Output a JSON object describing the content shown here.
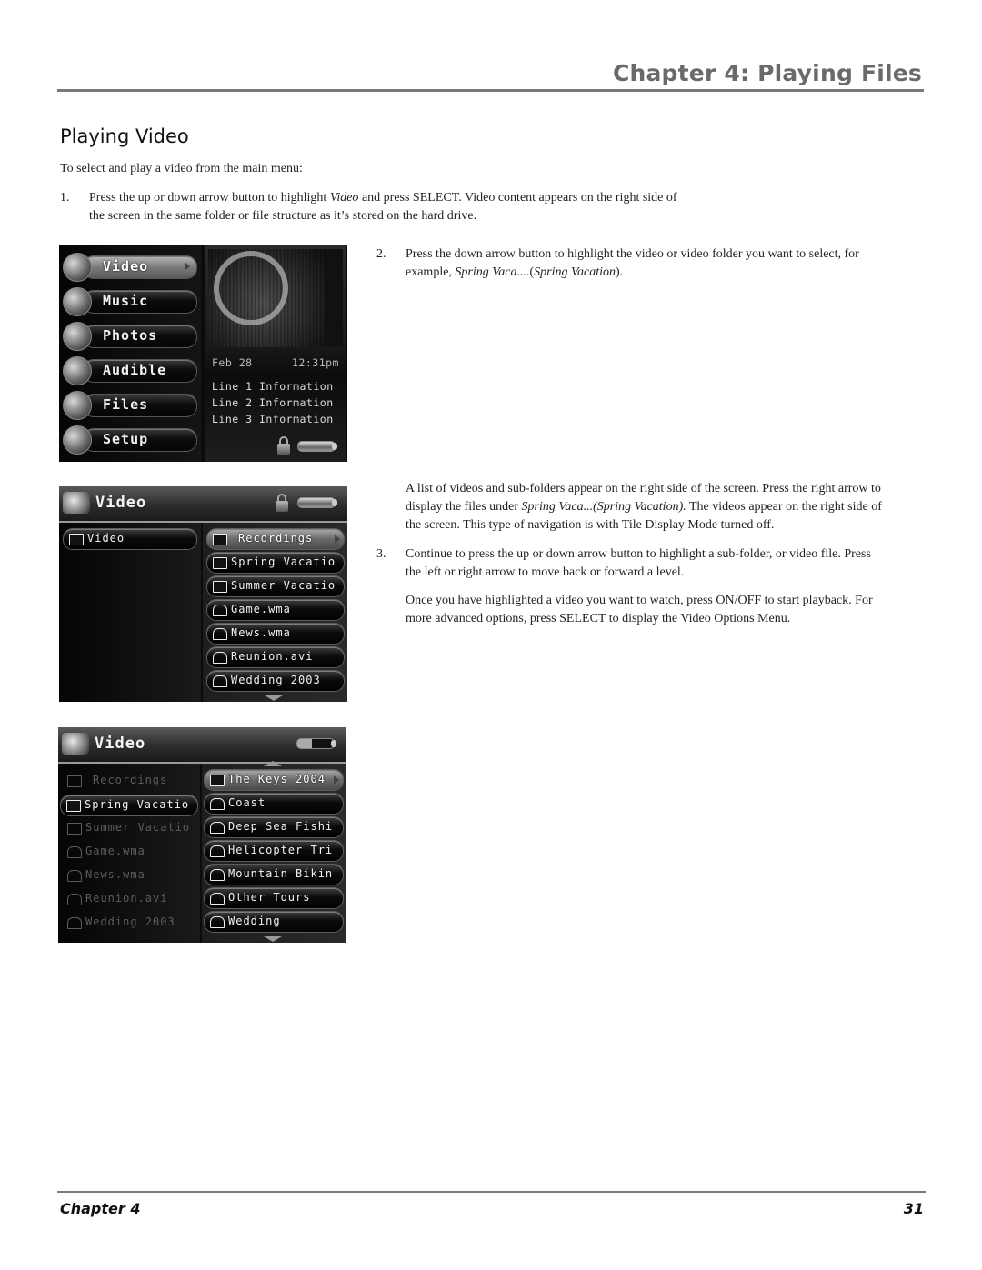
{
  "header": {
    "chapter_title": "Chapter 4: Playing Files"
  },
  "section": {
    "title": "Playing Video",
    "intro": "To select and play a video from the main menu:"
  },
  "steps": [
    {
      "num": "1.",
      "line1_a": "Press the up or down arrow button to highlight ",
      "line1_em": "Video",
      "line1_b": " and press SELECT. Video content appears on the right side of",
      "line2": "the screen in the same folder or file structure as it’s stored on the hard drive."
    },
    {
      "num": "2.",
      "line1": "Press the down arrow button to highlight the video or video folder you want to select, for",
      "line2_a": "example, ",
      "line2_em1": "Spring Vaca...",
      "line2_b": ".(",
      "line2_em2": "Spring Vacation",
      "line2_c": ")."
    },
    {
      "num": "3.",
      "line1": "Continue to press the up or down arrow button to highlight a sub-folder, or video file. Press",
      "line2": "the left or right arrow to move back or forward a level."
    }
  ],
  "paragraphs": {
    "list_desc_l1": "A list of videos and sub-folders appear on the right side of the screen. Press the right arrow to",
    "list_desc_l2_a": "display the files under ",
    "list_desc_l2_em": "Spring Vaca...(Spring Vacation).",
    "list_desc_l2_b": " The videos appear on the right side of",
    "list_desc_l3": "the screen. This type of navigation is with Tile Display Mode turned off.",
    "playback_l1": "Once you have highlighted a video you want to watch, press ON/OFF to start playback. For",
    "playback_l2": "more advanced options, press SELECT to display the Video Options Menu."
  },
  "screen1": {
    "menu": [
      {
        "label": "Video",
        "icon": "camcorder-icon",
        "active": true
      },
      {
        "label": "Music",
        "icon": "headphones-icon"
      },
      {
        "label": "Photos",
        "icon": "camera-icon"
      },
      {
        "label": "Audible",
        "icon": "speaker-book-icon"
      },
      {
        "label": "Files",
        "icon": "files-icon"
      },
      {
        "label": "Setup",
        "icon": "gear-icon"
      }
    ],
    "date": "Feb 28",
    "time": "12:31pm",
    "info_lines": [
      "Line 1 Information",
      "Line 2 Information",
      "Line 3 Information"
    ]
  },
  "screen2": {
    "title": "Video",
    "left": [
      {
        "label": "Video",
        "icon": "open-folder"
      }
    ],
    "right": [
      {
        "label": "Recordings",
        "icon": "folder",
        "highlight": true
      },
      {
        "label": "Spring Vacatio",
        "icon": "folder"
      },
      {
        "label": "Summer Vacatio",
        "icon": "folder"
      },
      {
        "label": "Game.wma",
        "icon": "film"
      },
      {
        "label": "News.wma",
        "icon": "film"
      },
      {
        "label": "Reunion.avi",
        "icon": "film"
      },
      {
        "label": "Wedding 2003",
        "icon": "film"
      }
    ]
  },
  "screen3": {
    "title": "Video",
    "left": [
      {
        "label": "Recordings",
        "icon": "folder",
        "dim": true
      },
      {
        "label": "Spring Vacatio",
        "icon": "open-folder",
        "selected": true
      },
      {
        "label": "Summer Vacatio",
        "icon": "folder",
        "dim": true
      },
      {
        "label": "Game.wma",
        "icon": "film",
        "dim": true
      },
      {
        "label": "News.wma",
        "icon": "film",
        "dim": true
      },
      {
        "label": "Reunion.avi",
        "icon": "film",
        "dim": true
      },
      {
        "label": "Wedding 2003",
        "icon": "film",
        "dim": true
      }
    ],
    "right": [
      {
        "label": "The Keys 2004",
        "icon": "folder",
        "highlight": true
      },
      {
        "label": "Coast",
        "icon": "film"
      },
      {
        "label": "Deep Sea Fishi",
        "icon": "film"
      },
      {
        "label": "Helicopter Tri",
        "icon": "film"
      },
      {
        "label": "Mountain Bikin",
        "icon": "film"
      },
      {
        "label": "Other Tours",
        "icon": "film"
      },
      {
        "label": "Wedding",
        "icon": "film"
      }
    ]
  },
  "footer": {
    "chapter": "Chapter 4",
    "page": "31"
  }
}
